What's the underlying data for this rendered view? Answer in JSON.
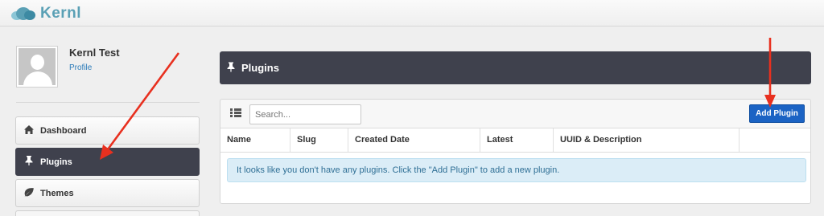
{
  "app": {
    "brand": "Kernl",
    "logo_icon": "cloud-logo-icon"
  },
  "profile": {
    "name": "Kernl Test",
    "link": "Profile"
  },
  "sidebar": {
    "items": [
      {
        "label": "Dashboard",
        "icon": "home-icon",
        "active": false
      },
      {
        "label": "Plugins",
        "icon": "pin-icon",
        "active": true
      },
      {
        "label": "Themes",
        "icon": "leaf-icon",
        "active": false
      }
    ]
  },
  "main": {
    "title": "Plugins",
    "title_icon": "pin-icon",
    "search_placeholder": "Search...",
    "add_button": "Add Plugin",
    "columns": [
      "Name",
      "Slug",
      "Created Date",
      "Latest",
      "UUID & Description",
      ""
    ],
    "empty_message": "It looks like you don't have any plugins. Click the \"Add Plugin\" to add a new plugin."
  },
  "colors": {
    "nav_active": "#3f414d",
    "primary_button": "#1b63c4",
    "alert_bg": "#dbedf7",
    "annotation_arrow": "#e8301f"
  }
}
